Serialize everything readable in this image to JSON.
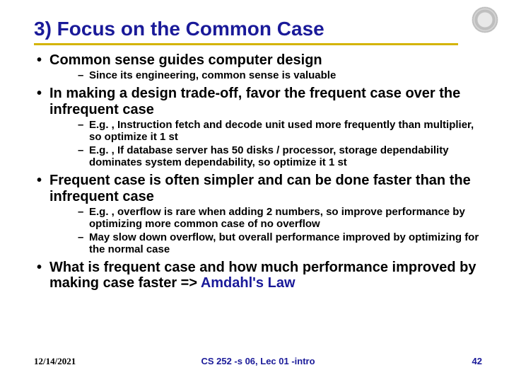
{
  "title": "3) Focus on the Common Case",
  "bullets": [
    {
      "text": "Common sense guides computer design",
      "sub": [
        "Since its engineering, common sense is valuable"
      ]
    },
    {
      "text": "In making a design trade-off, favor the frequent case over the infrequent case",
      "sub": [
        "E.g. , Instruction fetch and decode unit used more frequently than multiplier, so optimize it 1 st",
        "E.g. , If database server has 50 disks / processor, storage dependability dominates system dependability, so optimize it 1 st"
      ]
    },
    {
      "text": "Frequent case is often simpler and can be done faster than the infrequent case",
      "sub": [
        "E.g. , overflow is rare when adding 2 numbers, so improve performance by optimizing more common case of no overflow",
        "May slow down overflow, but overall performance improved by optimizing for the normal case"
      ]
    },
    {
      "text_prefix": "What is frequent case and how much performance improved by making case faster => ",
      "text_emph": "Amdahl's Law",
      "sub": []
    }
  ],
  "footer": {
    "date": "12/14/2021",
    "center": "CS 252 -s 06, Lec 01 -intro",
    "page": "42"
  }
}
